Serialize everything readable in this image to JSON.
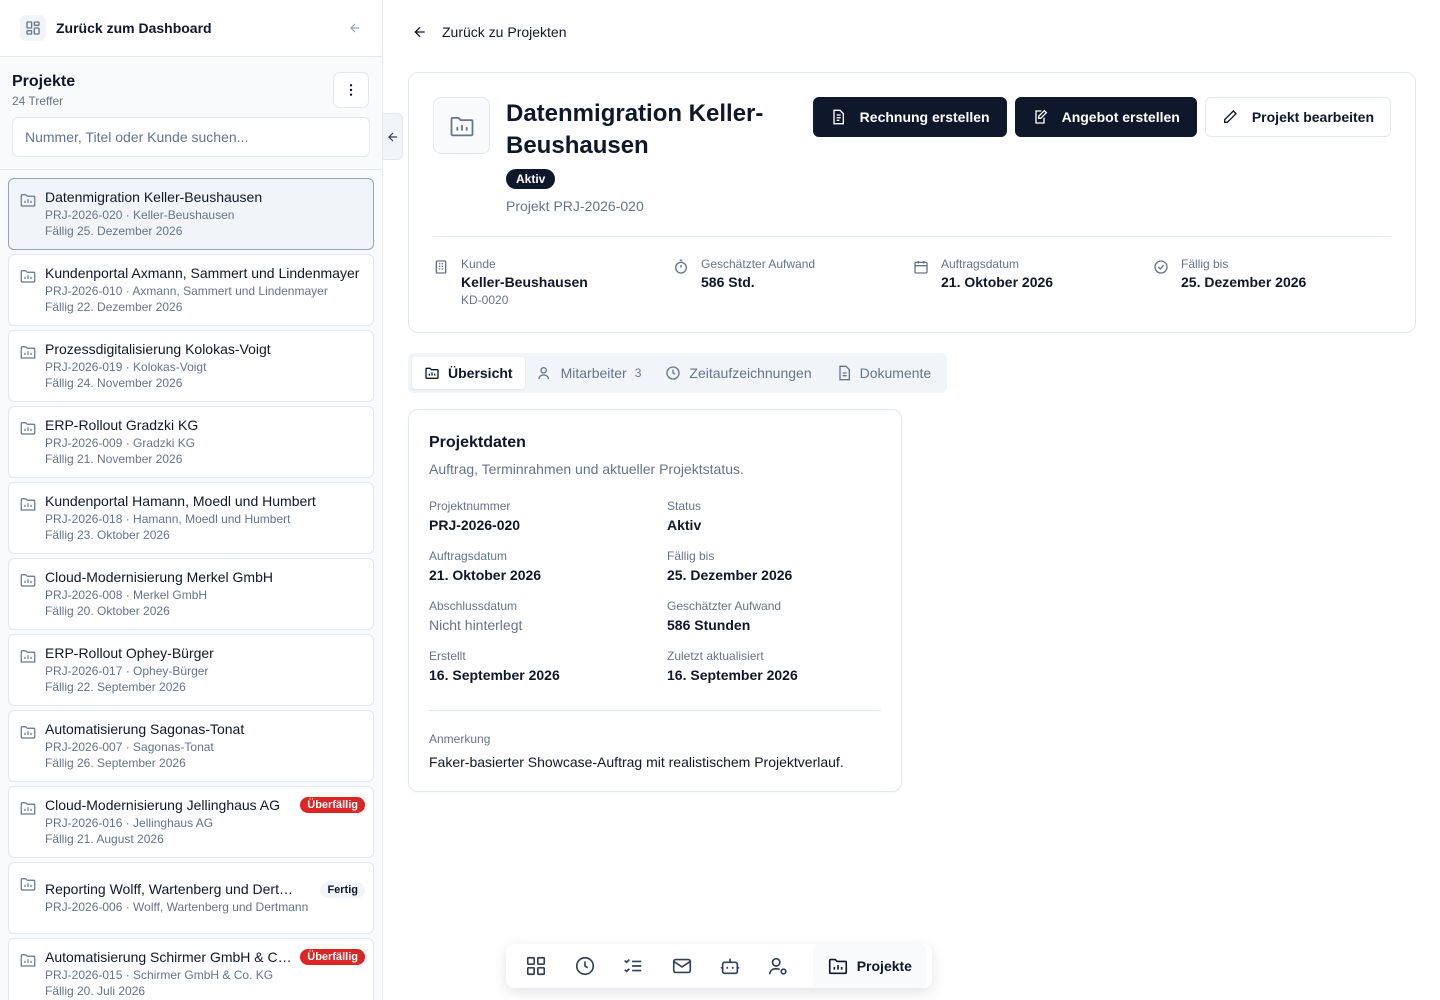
{
  "sidebar": {
    "back_label": "Zurück zum Dashboard",
    "title": "Projekte",
    "count": "24 Treffer",
    "search_placeholder": "Nummer, Titel oder Kunde suchen...",
    "projects": [
      {
        "title": "Datenmigration Keller-Beushausen",
        "sub": "PRJ-2026-020 · Keller-Beushausen",
        "due": "Fällig 25. Dezember 2026",
        "badge": ""
      },
      {
        "title": "Kundenportal Axmann, Sammert und Lindenmayer",
        "sub": "PRJ-2026-010 · Axmann, Sammert und Lindenmayer",
        "due": "Fällig 22. Dezember 2026",
        "badge": ""
      },
      {
        "title": "Prozessdigitalisierung Kolokas-Voigt",
        "sub": "PRJ-2026-019 · Kolokas-Voigt",
        "due": "Fällig 24. November 2026",
        "badge": ""
      },
      {
        "title": "ERP-Rollout Gradzki KG",
        "sub": "PRJ-2026-009 · Gradzki KG",
        "due": "Fällig 21. November 2026",
        "badge": ""
      },
      {
        "title": "Kundenportal Hamann, Moedl und Humbert",
        "sub": "PRJ-2026-018 · Hamann, Moedl und Humbert",
        "due": "Fällig 23. Oktober 2026",
        "badge": ""
      },
      {
        "title": "Cloud-Modernisierung Merkel GmbH",
        "sub": "PRJ-2026-008 · Merkel GmbH",
        "due": "Fällig 20. Oktober 2026",
        "badge": ""
      },
      {
        "title": "ERP-Rollout Ophey-Bürger",
        "sub": "PRJ-2026-017 · Ophey-Bürger",
        "due": "Fällig 22. September 2026",
        "badge": ""
      },
      {
        "title": "Automatisierung Sagonas-Tonat",
        "sub": "PRJ-2026-007 · Sagonas-Tonat",
        "due": "Fällig 26. September 2026",
        "badge": ""
      },
      {
        "title": "Cloud-Modernisierung Jellinghaus AG",
        "sub": "PRJ-2026-016 · Jellinghaus AG",
        "due": "Fällig 21. August 2026",
        "badge": "Überfällig"
      },
      {
        "title": "Reporting Wolff, Wartenberg und Dertmann",
        "sub": "PRJ-2026-006 · Wolff, Wartenberg und Dertmann",
        "due": "",
        "badge": "Fertig"
      },
      {
        "title": "Automatisierung Schirmer GmbH & Co. KG",
        "sub": "PRJ-2026-015 · Schirmer GmbH & Co. KG",
        "due": "Fällig 20. Juli 2026",
        "badge": "Überfällig"
      }
    ]
  },
  "main": {
    "back_label": "Zurück zu Projekten",
    "title": "Datenmigration Keller-Beushausen",
    "status": "Aktiv",
    "project_number": "Projekt PRJ-2026-020",
    "actions": {
      "invoice": "Rechnung erstellen",
      "offer": "Angebot erstellen",
      "edit": "Projekt bearbeiten"
    },
    "meta": {
      "customer": {
        "label": "Kunde",
        "value": "Keller-Beushausen",
        "sub": "KD-0020"
      },
      "effort": {
        "label": "Geschätzter Aufwand",
        "value": "586 Std."
      },
      "order_date": {
        "label": "Auftragsdatum",
        "value": "21. Oktober 2026"
      },
      "due": {
        "label": "Fällig bis",
        "value": "25. Dezember 2026"
      }
    },
    "tabs": {
      "overview": "Übersicht",
      "staff": "Mitarbeiter",
      "staff_count": "3",
      "time": "Zeitaufzeichnungen",
      "docs": "Dokumente"
    },
    "card": {
      "title": "Projektdaten",
      "description": "Auftrag, Terminrahmen und aktueller Projektstatus.",
      "fields": [
        {
          "label": "Projektnummer",
          "value": "PRJ-2026-020"
        },
        {
          "label": "Status",
          "value": "Aktiv"
        },
        {
          "label": "Auftragsdatum",
          "value": "21. Oktober 2026"
        },
        {
          "label": "Fällig bis",
          "value": "25. Dezember 2026"
        },
        {
          "label": "Abschlussdatum",
          "value": "Nicht hinterlegt"
        },
        {
          "label": "Geschätzter Aufwand",
          "value": "586 Stunden"
        },
        {
          "label": "Erstellt",
          "value": "16. September 2026"
        },
        {
          "label": "Zuletzt aktualisiert",
          "value": "16. September 2026"
        }
      ],
      "note_label": "Anmerkung",
      "note_value": "Faker-basierter Showcase-Auftrag mit realistischem Projektverlauf."
    }
  },
  "dock": {
    "active_label": "Projekte",
    "icons": [
      "dashboard-icon",
      "clock-icon",
      "task-list-icon",
      "mail-icon",
      "bot-icon",
      "user-settings-icon"
    ]
  },
  "colors": {
    "primary": "#0f172a",
    "danger": "#dc2626",
    "muted": "#64748b",
    "border": "#e2e8f0"
  }
}
